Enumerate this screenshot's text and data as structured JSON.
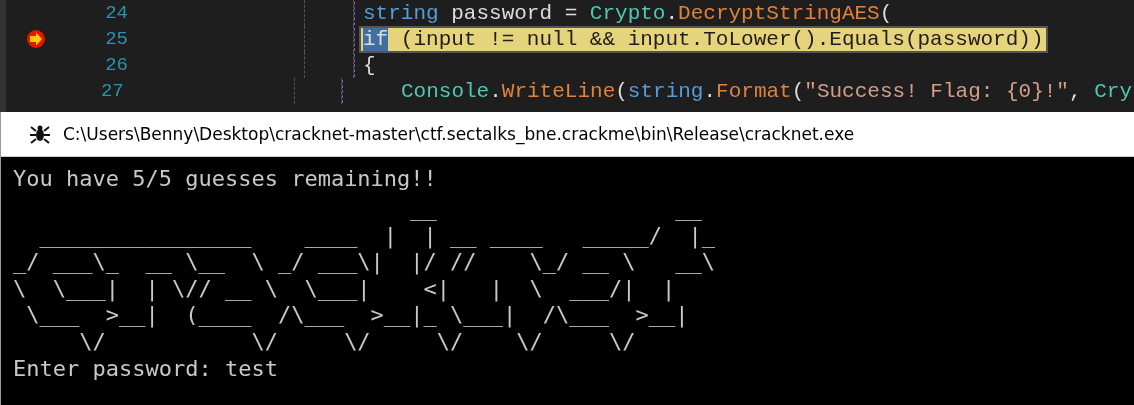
{
  "editor": {
    "lines": [
      {
        "number": "24",
        "breakpoint": false,
        "current": false,
        "segments": [
          {
            "kind": "keyword",
            "text": "string"
          },
          {
            "kind": "plain",
            "text": " password = "
          },
          {
            "kind": "type",
            "text": "Crypto"
          },
          {
            "kind": "plain",
            "text": "."
          },
          {
            "kind": "method",
            "text": "DecryptStringAES"
          },
          {
            "kind": "plain",
            "text": "("
          }
        ]
      },
      {
        "number": "25",
        "breakpoint": true,
        "current": true,
        "segments": [
          {
            "kind": "selection",
            "text": "if"
          },
          {
            "kind": "plain",
            "text": " (input != null && input.ToLower().Equals(password))"
          }
        ]
      },
      {
        "number": "26",
        "breakpoint": false,
        "current": false,
        "segments": [
          {
            "kind": "plain",
            "text": "{"
          }
        ],
        "children": [
          {
            "number": "27",
            "breakpoint": false,
            "current": false,
            "segments": [
              {
                "kind": "type",
                "text": "Console"
              },
              {
                "kind": "plain",
                "text": "."
              },
              {
                "kind": "method",
                "text": "WriteLine"
              },
              {
                "kind": "plain",
                "text": "("
              },
              {
                "kind": "keyword",
                "text": "string"
              },
              {
                "kind": "plain",
                "text": "."
              },
              {
                "kind": "method",
                "text": "Format"
              },
              {
                "kind": "plain",
                "text": "("
              },
              {
                "kind": "string",
                "text": "\"Success! Flag: {0}!\""
              },
              {
                "kind": "plain",
                "text": ", "
              },
              {
                "kind": "type",
                "text": "Cry"
              }
            ]
          }
        ]
      }
    ]
  },
  "console": {
    "title": "C:\\Users\\Benny\\Desktop\\cracknet-master\\ctf.sectalks_bne.crackme\\bin\\Release\\cracknet.exe",
    "output": "You have 5/5 guesses remaining!!",
    "art": [
      "                              __                  __",
      "  ________________    ____  |  | __ ____   _____/  |_",
      "_/ ___\\_  __ \\__  \\ _/ ___\\|  |/ //    \\_/ __ \\   __\\",
      "\\  \\___|  | \\// __ \\  \\___|    <|   |  \\  ___/|  |",
      " \\___  >__|  (____  /\\___  >__|_ \\___|  /\\___  >__|",
      "     \\/           \\/     \\/     \\/    \\/     \\/"
    ],
    "prompt": "Enter password:",
    "input": "test"
  }
}
